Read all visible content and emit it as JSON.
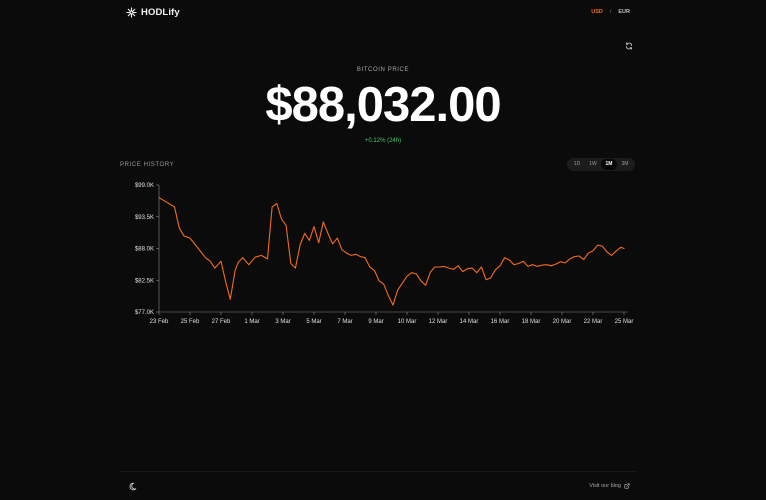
{
  "header": {
    "brand": "HODLify",
    "currency": {
      "active": "USD",
      "separator": "/",
      "other": "EUR"
    }
  },
  "icons": {
    "brand": "bitcoin-snowflake-icon",
    "refresh": "refresh-icon",
    "theme": "theme-toggle-icon",
    "external": "external-link-icon"
  },
  "colors": {
    "accent": "#f26b1d",
    "line": "#f26b1d",
    "positive": "#3ec873",
    "background": "#0b0b0b"
  },
  "hero": {
    "label": "BITCOIN PRICE",
    "price": "$88,032.00",
    "change": "+0.12% (24h)"
  },
  "history": {
    "label": "PRICE HISTORY",
    "ranges": [
      "1D",
      "1W",
      "1M",
      "3M"
    ],
    "active_range": "1M"
  },
  "footer": {
    "blog_label": "Visit our blog"
  },
  "chart_data": {
    "type": "line",
    "title": "",
    "xlabel": "",
    "ylabel": "",
    "ylim": [
      77000,
      99000
    ],
    "yticks": [
      99000,
      93500,
      88000,
      82500,
      77000
    ],
    "ytick_labels": [
      "$99.0K",
      "$93.5K",
      "$88.0K",
      "$82.5K",
      "$77.0K"
    ],
    "xlim": [
      0,
      30
    ],
    "xticks": [
      0,
      2,
      4,
      6,
      8,
      10,
      12,
      14,
      16,
      18,
      20,
      22,
      24,
      26,
      28,
      30
    ],
    "xtick_labels": [
      "23 Feb",
      "25 Feb",
      "27 Feb",
      "1 Mar",
      "3 Mar",
      "5 Mar",
      "7 Mar",
      "9 Mar",
      "10 Mar",
      "12 Mar",
      "14 Mar",
      "16 Mar",
      "18 Mar",
      "20 Mar",
      "22 Mar",
      "25 Mar"
    ],
    "grid": false,
    "series": [
      {
        "x": [
          0,
          0.5,
          1,
          1.3,
          1.6,
          2,
          2.5,
          3,
          3.3,
          3.6,
          4,
          4.3,
          4.6,
          4.9,
          5.1,
          5.4,
          5.8,
          6.2,
          6.6,
          7,
          7.3,
          7.6,
          7.9,
          8.2,
          8.5,
          8.8,
          9.1,
          9.4,
          9.7,
          10,
          10.3,
          10.6,
          10.9,
          11.2,
          11.5,
          11.8,
          12.1,
          12.4,
          12.7,
          13,
          13.3,
          13.6,
          13.9,
          14.2,
          14.5,
          14.8,
          15.1,
          15.4,
          15.7,
          16,
          16.3,
          16.6,
          16.9,
          17.2,
          17.5,
          17.8,
          18.1,
          18.4,
          18.7,
          19,
          19.3,
          19.6,
          19.9,
          20.2,
          20.5,
          20.8,
          21.1,
          21.4,
          21.7,
          22,
          22.3,
          22.6,
          22.9,
          23.2,
          23.5,
          23.8,
          24.1,
          24.4,
          24.7,
          25,
          25.3,
          25.6,
          25.9,
          26.2,
          26.5,
          26.8,
          27.1,
          27.4,
          27.7,
          28,
          28.3,
          28.6,
          28.9,
          29.2,
          29.5,
          29.8,
          30
        ],
        "y": [
          96800,
          96000,
          95200,
          91600,
          90200,
          89800,
          88100,
          86400,
          85800,
          84600,
          85800,
          82200,
          79200,
          84100,
          85600,
          86400,
          85200,
          86500,
          86800,
          86200,
          95200,
          95800,
          93100,
          92000,
          85400,
          84600,
          88600,
          90600,
          89400,
          91800,
          89000,
          92600,
          90600,
          88800,
          89800,
          87800,
          87200,
          86800,
          87000,
          86600,
          86400,
          84800,
          84200,
          82400,
          81800,
          79800,
          78200,
          80800,
          82000,
          83200,
          83800,
          83600,
          82400,
          81600,
          83900,
          84800,
          84800,
          84900,
          84600,
          84400,
          85000,
          84000,
          84500,
          84600,
          83800,
          84800,
          82600,
          82900,
          84300,
          85000,
          86400,
          86000,
          85200,
          85400,
          85800,
          84900,
          85200,
          84900,
          85100,
          85200,
          85000,
          85300,
          85700,
          85500,
          86200,
          86600,
          86700,
          86100,
          87200,
          87600,
          88600,
          88400,
          87400,
          86800,
          87600,
          88200,
          88000
        ]
      }
    ]
  }
}
